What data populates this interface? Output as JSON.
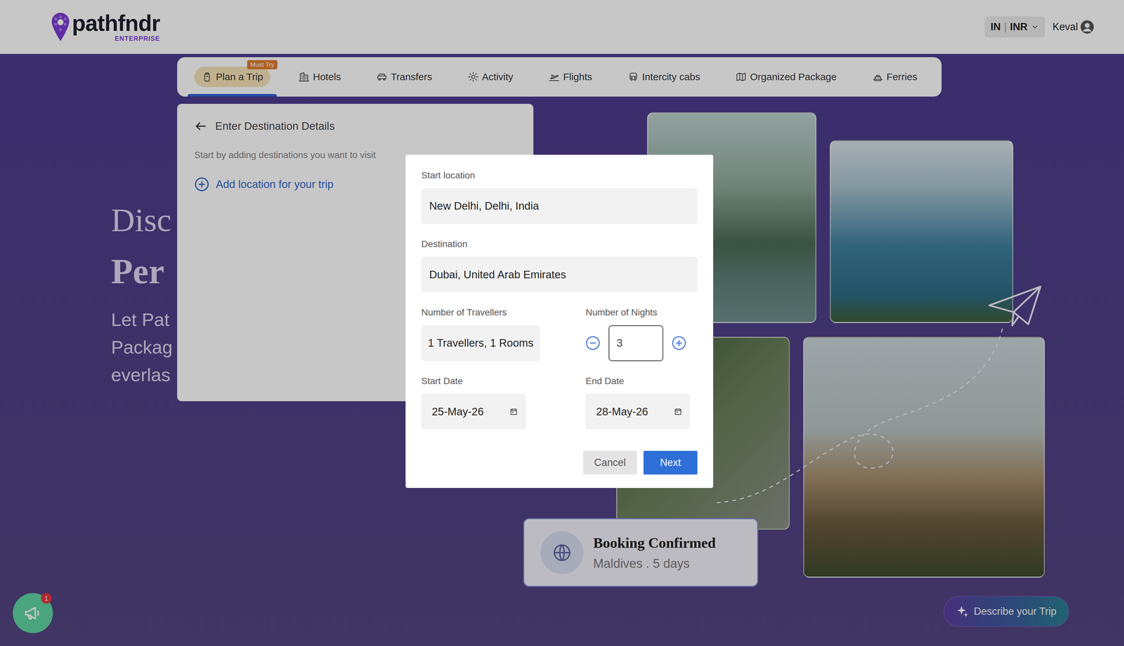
{
  "header": {
    "logo": "pathfndr",
    "logo_sub": "ENTERPRISE",
    "locale": "IN",
    "separator": "|",
    "currency": "INR",
    "user": "Keval"
  },
  "tabs": [
    {
      "label": "Plan a Trip",
      "selected": true,
      "badge": "Must Try"
    },
    {
      "label": "Hotels",
      "selected": false
    },
    {
      "label": "Transfers",
      "selected": false
    },
    {
      "label": "Activity",
      "selected": false
    },
    {
      "label": "Flights",
      "selected": false
    },
    {
      "label": "Intercity cabs",
      "selected": false
    },
    {
      "label": "Organized Package",
      "selected": false
    },
    {
      "label": "Ferries",
      "selected": false
    }
  ],
  "hero": {
    "headings": [
      "Disc",
      "Per"
    ],
    "body": [
      "Let Pat",
      "Packag",
      "everlas"
    ]
  },
  "panel": {
    "title": "Enter Destination Details",
    "subtitle": "Start by adding destinations you want to visit",
    "add_link": "Add location for your trip"
  },
  "modal": {
    "start_location": {
      "label": "Start location",
      "value": "New Delhi, Delhi, India"
    },
    "destination": {
      "label": "Destination",
      "value": "Dubai, United Arab Emirates"
    },
    "travellers": {
      "label": "Number of Travellers",
      "value": "1 Travellers, 1 Rooms"
    },
    "nights": {
      "label": "Number of Nights",
      "value": "3"
    },
    "start_date": {
      "label": "Start Date",
      "value": "25-May-26"
    },
    "end_date": {
      "label": "End Date",
      "value": "28-May-26"
    },
    "buttons": [
      {
        "label": "Cancel",
        "kind": "secondary"
      },
      {
        "label": "Next",
        "kind": "primary"
      }
    ]
  },
  "booking_card": {
    "title": "Booking Confirmed",
    "subtitle": "Maldives . 5 days"
  },
  "notifications": {
    "count": "1"
  },
  "describe_button": "Describe your Trip"
}
